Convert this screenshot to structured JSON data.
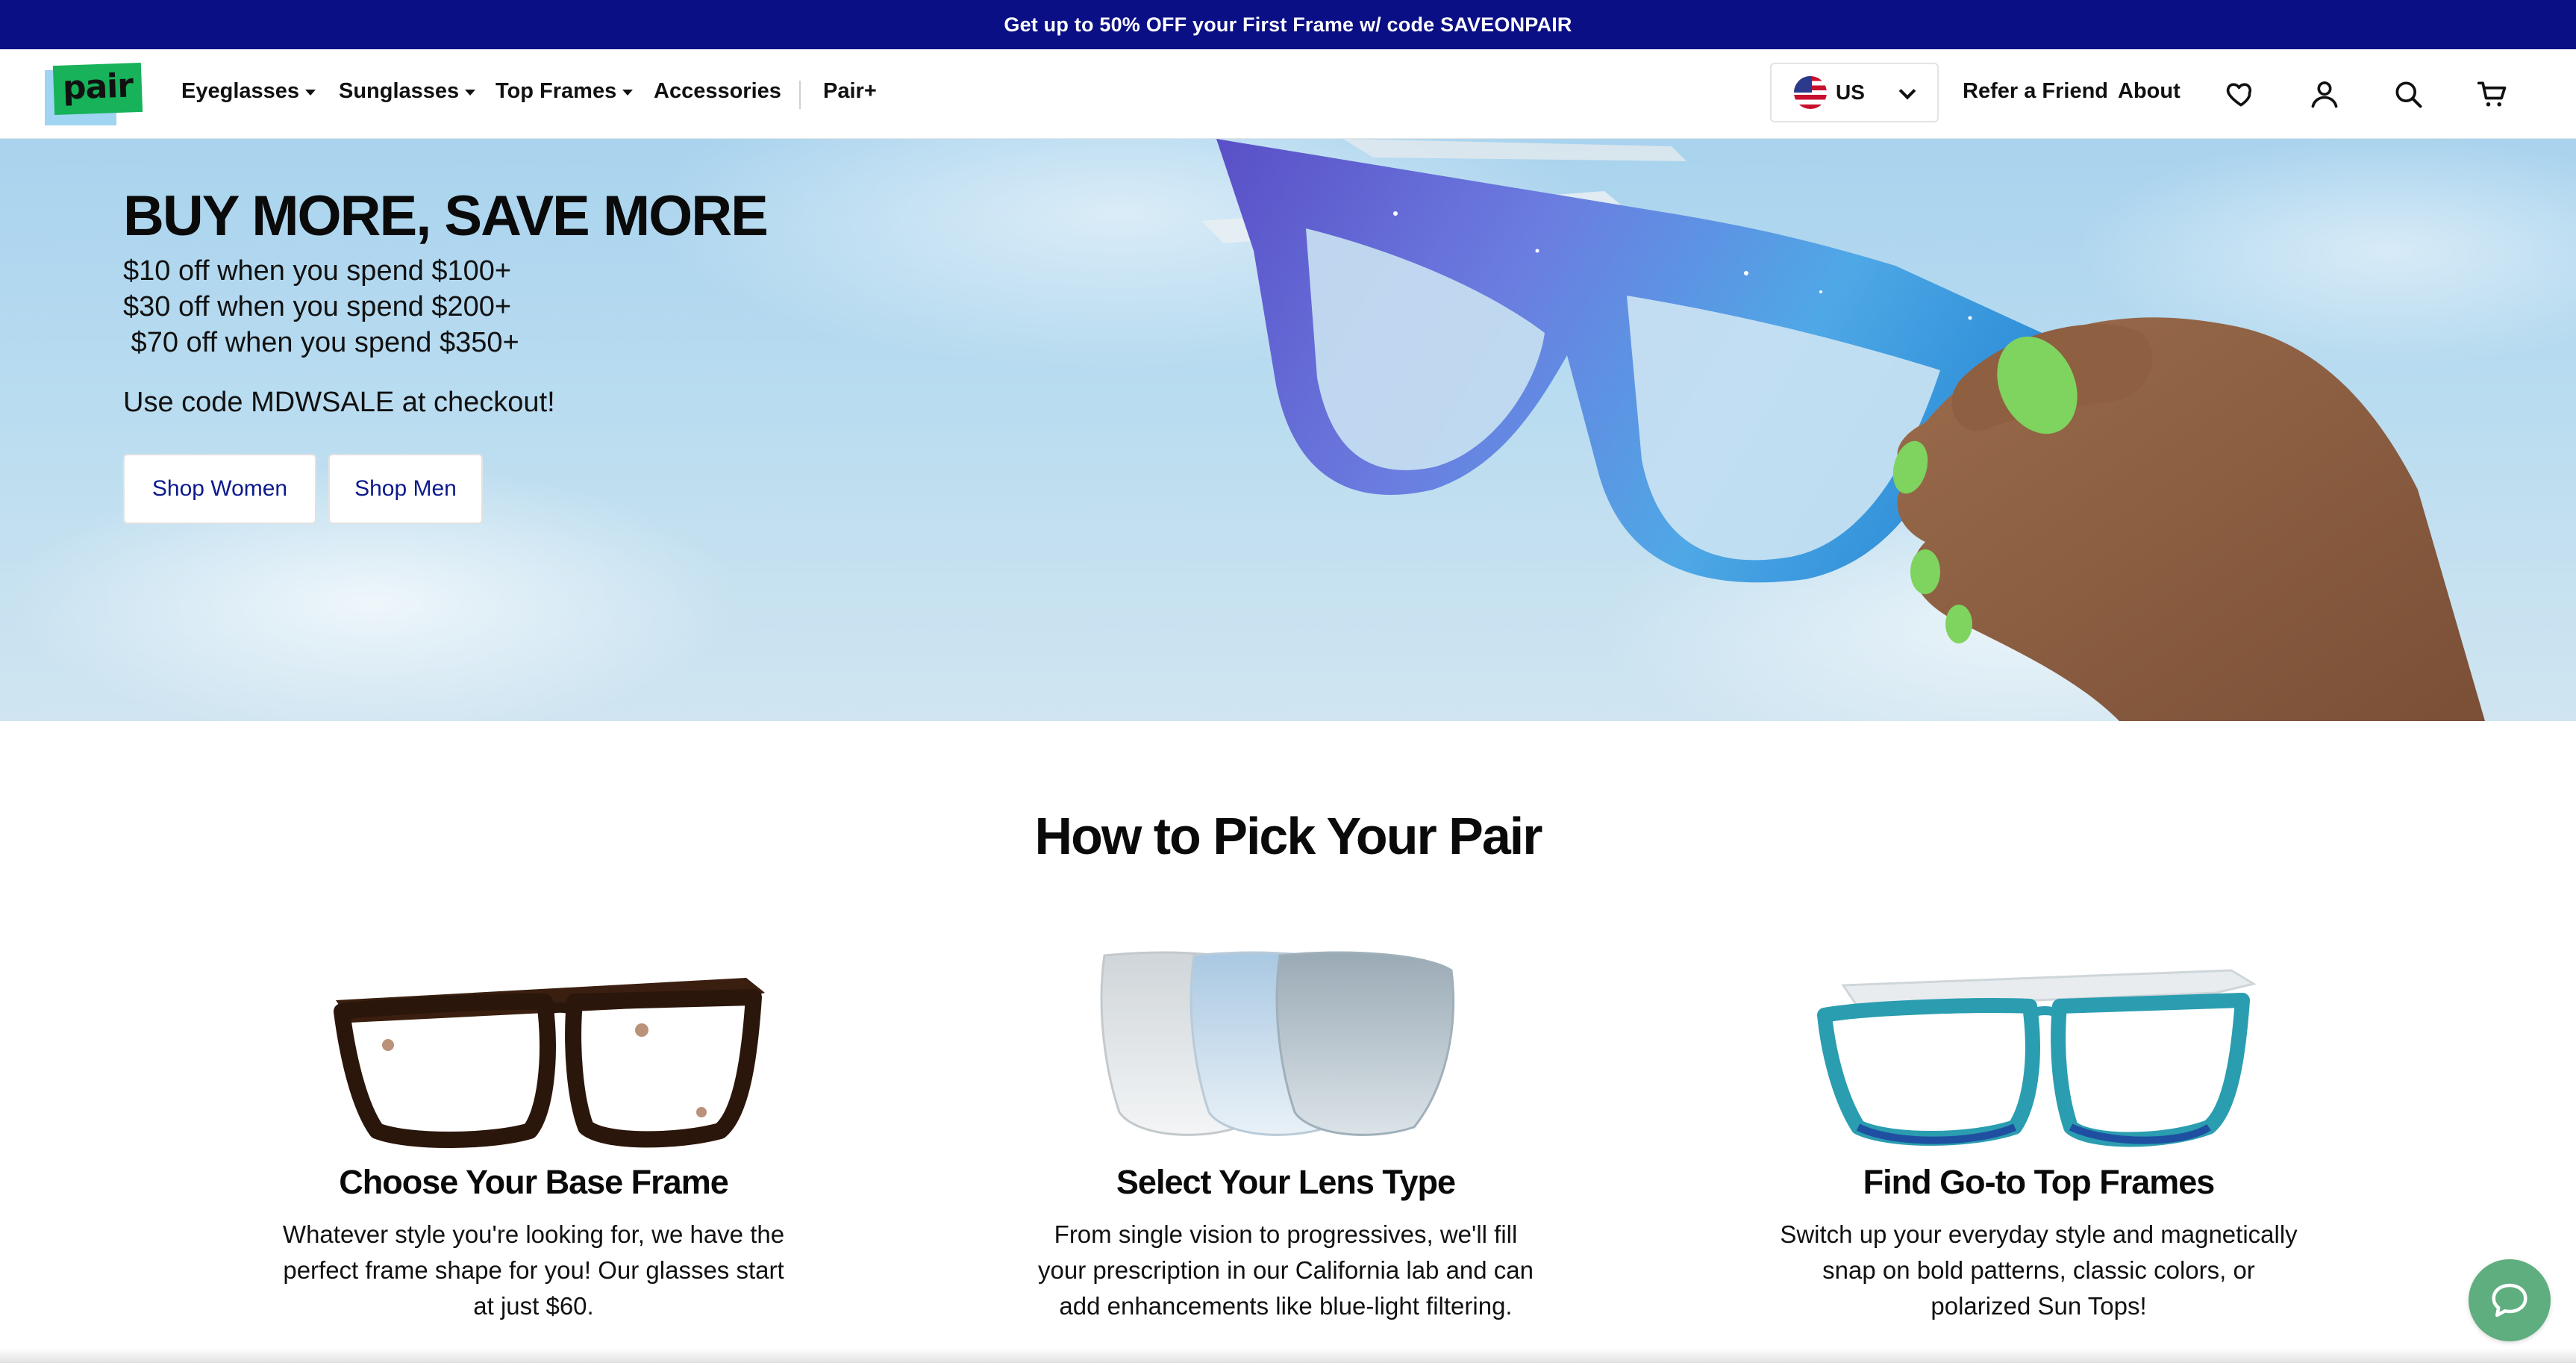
{
  "promo": {
    "text": "Get up to 50% OFF your First Frame w/ code SAVEONPAIR"
  },
  "nav": {
    "logo": "pair",
    "items": [
      {
        "label": "Eyeglasses",
        "dropdown": true
      },
      {
        "label": "Sunglasses",
        "dropdown": true
      },
      {
        "label": "Top Frames",
        "dropdown": true
      },
      {
        "label": "Accessories",
        "dropdown": false
      },
      {
        "label": "Pair+",
        "dropdown": false
      }
    ],
    "country": "US",
    "refer": "Refer a Friend",
    "about": "About",
    "icons": [
      "heart-icon",
      "user-icon",
      "search-icon",
      "cart-icon"
    ]
  },
  "hero": {
    "title": "BUY MORE, SAVE MORE",
    "lines": [
      "$10 off when you spend $100+",
      "$30 off when you spend $200+",
      " $70 off when you spend $350+"
    ],
    "code_line": "Use code MDWSALE at checkout!",
    "btn_women": "Shop Women",
    "btn_men": "Shop Men"
  },
  "how": {
    "title": "How to Pick Your Pair",
    "cards": [
      {
        "title": "Choose Your Base Frame",
        "desc": "Whatever style you're looking for, we have the perfect frame shape for you! Our glasses start at just $60."
      },
      {
        "title": "Select Your Lens Type",
        "desc": "From single vision to progressives, we'll fill your prescription in our California lab and can add enhancements like blue-light filtering."
      },
      {
        "title": "Find Go-to Top Frames",
        "desc": "Switch up your everyday style and magnetically snap on bold patterns, classic colors, or polarized Sun Tops!"
      }
    ]
  },
  "colors": {
    "promo_bg": "#0b0f85",
    "brand_green": "#17b25a",
    "chat_green": "#5fae7f",
    "button_text": "#0b1a8c"
  }
}
